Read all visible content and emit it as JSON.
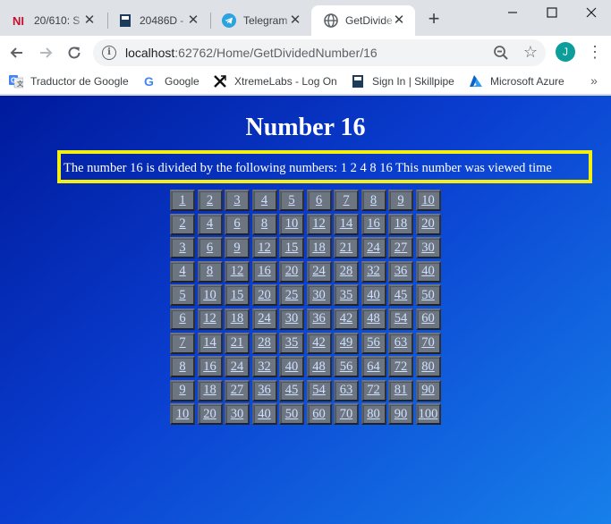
{
  "tabs": [
    {
      "title": "20/610: S",
      "icon": "ni-icon",
      "active": false
    },
    {
      "title": "20486D -",
      "icon": "book-icon",
      "active": false
    },
    {
      "title": "Telegram",
      "icon": "telegram-icon",
      "active": false
    },
    {
      "title": "GetDivide",
      "icon": "globe-icon",
      "active": true
    }
  ],
  "toolbar": {
    "url_host": "localhost",
    "url_path": ":62762/Home/GetDividedNumber/16",
    "avatar_letter": "J"
  },
  "bookmarks": [
    {
      "label": "Traductor de Google",
      "icon": "google-translate-icon"
    },
    {
      "label": "Google",
      "icon": "google-icon"
    },
    {
      "label": "XtremeLabs - Log On",
      "icon": "xtremelabs-icon"
    },
    {
      "label": "Sign In | Skillpipe",
      "icon": "skillpipe-icon"
    },
    {
      "label": "Microsoft Azure",
      "icon": "azure-icon"
    }
  ],
  "page": {
    "title": "Number 16",
    "divided_text": "The number 16 is divided by the following numbers: 1 2 4 8 16 This number was viewed time",
    "table": [
      [
        "1",
        "2",
        "3",
        "4",
        "5",
        "6",
        "7",
        "8",
        "9",
        "10"
      ],
      [
        "2",
        "4",
        "6",
        "8",
        "10",
        "12",
        "14",
        "16",
        "18",
        "20"
      ],
      [
        "3",
        "6",
        "9",
        "12",
        "15",
        "18",
        "21",
        "24",
        "27",
        "30"
      ],
      [
        "4",
        "8",
        "12",
        "16",
        "20",
        "24",
        "28",
        "32",
        "36",
        "40"
      ],
      [
        "5",
        "10",
        "15",
        "20",
        "25",
        "30",
        "35",
        "40",
        "45",
        "50"
      ],
      [
        "6",
        "12",
        "18",
        "24",
        "30",
        "36",
        "42",
        "48",
        "54",
        "60"
      ],
      [
        "7",
        "14",
        "21",
        "28",
        "35",
        "42",
        "49",
        "56",
        "63",
        "70"
      ],
      [
        "8",
        "16",
        "24",
        "32",
        "40",
        "48",
        "56",
        "64",
        "72",
        "80"
      ],
      [
        "9",
        "18",
        "27",
        "36",
        "45",
        "54",
        "63",
        "72",
        "81",
        "90"
      ],
      [
        "10",
        "20",
        "30",
        "40",
        "50",
        "60",
        "70",
        "80",
        "90",
        "100"
      ]
    ]
  },
  "colors": {
    "box_border": "#f4ef12",
    "cell_bg": "#6d7580",
    "link_text": "#cfe0ff"
  }
}
